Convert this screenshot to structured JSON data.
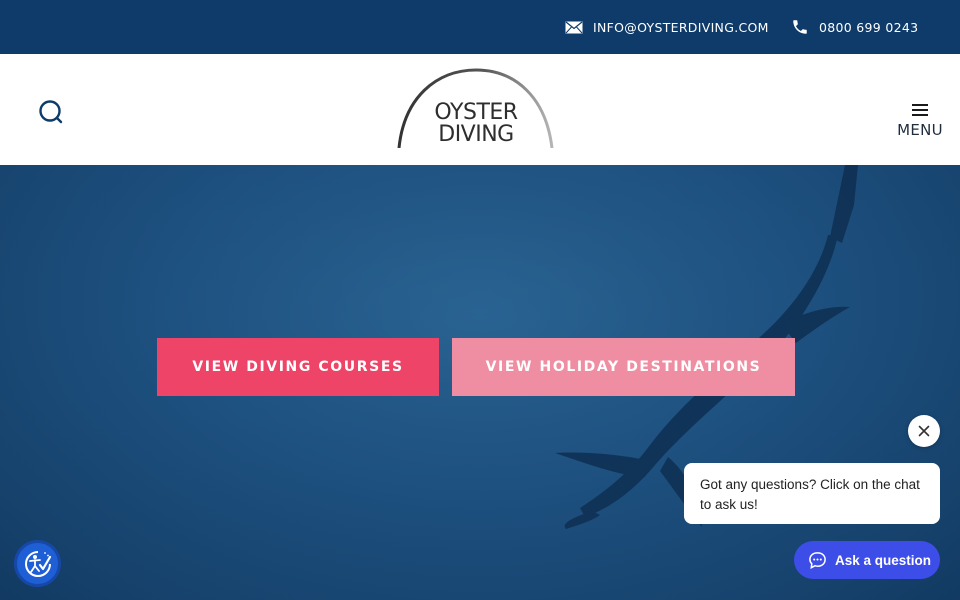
{
  "topbar": {
    "email": {
      "label": "INFO@OYSTERDIVING.COM",
      "icon": "envelope-icon"
    },
    "phone": {
      "label": "0800 699 0243",
      "icon": "phone-icon"
    }
  },
  "header": {
    "search_icon": "search-icon",
    "logo": {
      "line1": "OYSTER",
      "line2": "DIVING"
    },
    "menu": {
      "label": "MENU",
      "icon": "hamburger-icon"
    }
  },
  "hero": {
    "buttons": [
      {
        "label": "VIEW DIVING COURSES",
        "color": "#ee4468"
      },
      {
        "label": "VIEW HOLIDAY DESTINATIONS",
        "color": "#ef8ea2"
      }
    ]
  },
  "chat": {
    "prompt": "Got any questions? Click on the chat to ask us!",
    "button_label": "Ask a question",
    "button_color": "#3d4de8",
    "close_icon": "close-icon",
    "chat_icon": "chat-bubble-icon"
  },
  "accessibility": {
    "icon": "accessibility-icon"
  },
  "colors": {
    "topbar": "#0e3b69",
    "hero": "#1e5283"
  }
}
